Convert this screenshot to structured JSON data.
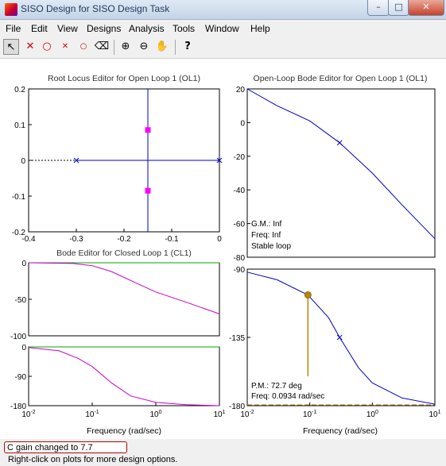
{
  "window": {
    "title": "SISO Design for SISO Design Task",
    "minimize": "–",
    "maximize": "□",
    "close": "✕"
  },
  "menu": [
    "File",
    "Edit",
    "View",
    "Designs",
    "Analysis",
    "Tools",
    "Window",
    "Help"
  ],
  "toolbar": {
    "tools": [
      {
        "name": "select-tool",
        "glyph": "↖",
        "pressed": true
      },
      {
        "name": "add-pole-tool",
        "glyph": "✕",
        "color": "#d40000"
      },
      {
        "name": "add-zero-tool",
        "glyph": "○",
        "color": "#d40000"
      },
      {
        "name": "add-pole-pair-tool",
        "glyph": "✕",
        "color": "#d40000"
      },
      {
        "name": "add-zero-pair-tool",
        "glyph": "○",
        "color": "#d40000"
      },
      {
        "name": "eraser-tool",
        "glyph": "⌫"
      },
      {
        "name": "zoom-in-tool",
        "glyph": "⊕"
      },
      {
        "name": "zoom-out-tool",
        "glyph": "⊖"
      },
      {
        "name": "pan-tool",
        "glyph": "✋"
      },
      {
        "name": "help-tool",
        "glyph": "?"
      }
    ]
  },
  "colors": {
    "axes_line": "#0000cc",
    "closed_loop_curve": "#cc00cc",
    "reference_line": "#00aa00",
    "phase_margin_marker": "#b8860b",
    "pole_marker": "#ff00ff"
  },
  "chart_data": [
    {
      "type": "scatter",
      "title": "Root Locus Editor for Open Loop 1 (OL1)",
      "xlim": [
        -0.4,
        0
      ],
      "ylim": [
        -0.2,
        0.2
      ],
      "xticks": [
        "-0.4",
        "-0.3",
        "-0.2",
        "-0.1",
        "0"
      ],
      "yticks": [
        "0.2",
        "0.1",
        "0",
        "-0.1",
        "-0.2"
      ],
      "open_loop_poles": [
        [
          -0.3,
          0
        ],
        [
          0,
          0
        ]
      ],
      "closed_loop_poles": [
        [
          -0.15,
          0.085
        ],
        [
          -0.15,
          -0.085
        ]
      ],
      "locus_breakaway": -0.15
    },
    {
      "type": "line",
      "title": "Open-Loop Bode Editor for Open Loop 1 (OL1)",
      "xscale": "log",
      "xlim": [
        0.01,
        10
      ],
      "xticks": [
        "10-2",
        "10-1",
        "100",
        "101"
      ],
      "xlabel": "Frequency (rad/sec)",
      "magnitude": {
        "ylim": [
          -80,
          20
        ],
        "yticks": [
          "20",
          "0",
          "-20",
          "-40",
          "-60",
          "-80"
        ],
        "x": [
          0.01,
          0.03,
          0.1,
          0.3,
          1,
          3,
          10
        ],
        "y": [
          20,
          10,
          1,
          -12,
          -30,
          -49,
          -69
        ],
        "pole_marker_x": 0.3,
        "annotations": [
          "G.M.: Inf",
          "Freq: Inf",
          "Stable loop"
        ]
      },
      "phase": {
        "ylim": [
          -180,
          -90
        ],
        "yticks": [
          "-90",
          "-135",
          "-180"
        ],
        "x": [
          0.01,
          0.03,
          0.0934,
          0.2,
          0.3,
          0.6,
          1,
          3,
          10
        ],
        "y": [
          -92,
          -97,
          -107,
          -122,
          -135,
          -155,
          -165,
          -175,
          -179
        ],
        "margin_freq": 0.0934,
        "annotations": [
          "P.M.: 72.7 deg",
          "Freq: 0.0934 rad/sec"
        ]
      }
    },
    {
      "type": "line",
      "title": "Bode Editor for Closed Loop 1 (CL1)",
      "xscale": "log",
      "xlim": [
        0.01,
        10
      ],
      "xticks": [
        "10-2",
        "10-1",
        "100",
        "101"
      ],
      "xlabel": "Frequency (rad/sec)",
      "magnitude": {
        "ylim": [
          -100,
          0
        ],
        "yticks": [
          "0",
          "-50",
          "-100"
        ],
        "x": [
          0.01,
          0.05,
          0.1,
          0.2,
          0.5,
          1,
          3,
          10
        ],
        "y": [
          0,
          -1,
          -4,
          -12,
          -28,
          -40,
          -54,
          -70
        ]
      },
      "phase": {
        "ylim": [
          -180,
          0
        ],
        "yticks": [
          "0",
          "-90",
          "-180"
        ],
        "x": [
          0.01,
          0.03,
          0.06,
          0.1,
          0.2,
          0.4,
          1,
          3,
          10
        ],
        "y": [
          -2,
          -12,
          -35,
          -60,
          -110,
          -150,
          -170,
          -177,
          -180
        ]
      }
    }
  ],
  "status": {
    "message": "C gain changed to 7.7",
    "hint": "Right-click on plots for more design options."
  }
}
